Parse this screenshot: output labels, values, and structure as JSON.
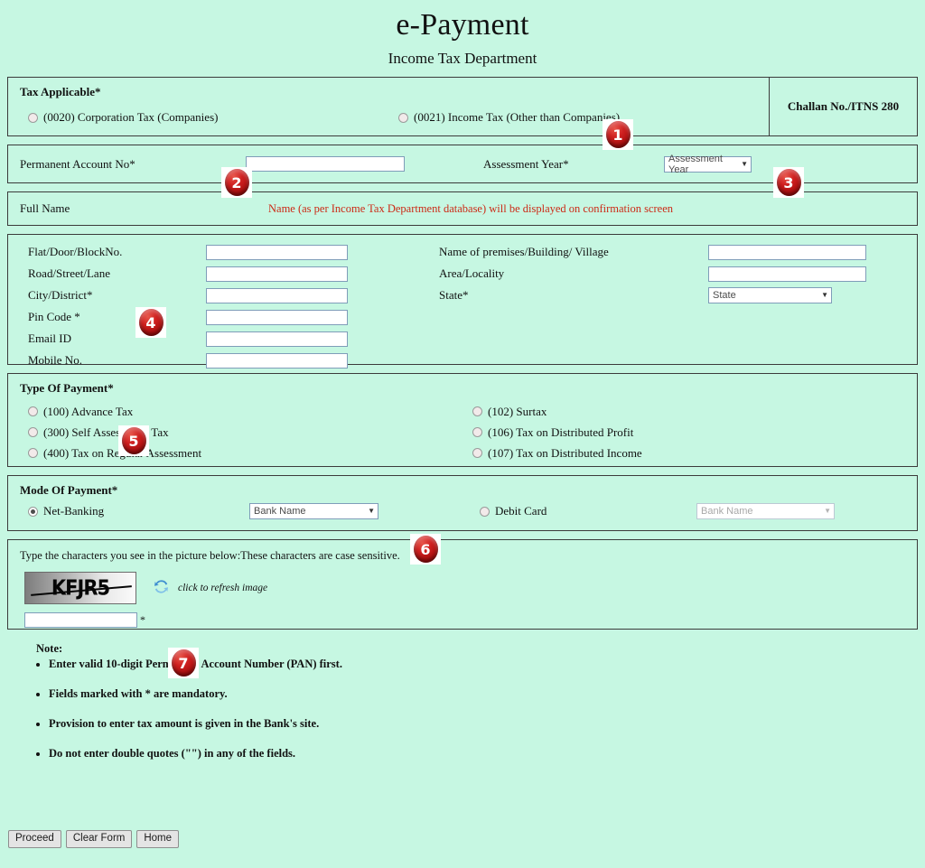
{
  "header": {
    "title": "e-Payment",
    "subtitle": "Income Tax Department"
  },
  "tax_applicable": {
    "title": "Tax Applicable*",
    "options": [
      {
        "label": "(0020) Corporation Tax (Companies)",
        "checked": false
      },
      {
        "label": "(0021) Income Tax (Other than Companies)",
        "checked": false
      }
    ],
    "challan_label": "Challan No./ITNS 280"
  },
  "pan": {
    "label": "Permanent Account No*",
    "value": "",
    "assessment_year_label": "Assessment Year*",
    "assessment_year_value": "Assessment Year"
  },
  "full_name": {
    "label": "Full Name",
    "note": "Name (as per Income Tax Department database) will be displayed on confirmation screen"
  },
  "address": {
    "left_fields": [
      {
        "label": "Flat/Door/BlockNo.",
        "value": ""
      },
      {
        "label": "Road/Street/Lane",
        "value": ""
      },
      {
        "label": "City/District*",
        "value": ""
      },
      {
        "label": "Pin Code *",
        "value": ""
      },
      {
        "label": "Email ID",
        "value": ""
      },
      {
        "label": "Mobile No.",
        "value": ""
      }
    ],
    "right_fields": [
      {
        "label": "Name of premises/Building/ Village",
        "value": "",
        "type": "text"
      },
      {
        "label": "Area/Locality",
        "value": "",
        "type": "text"
      },
      {
        "label": "State*",
        "value": "State",
        "type": "select"
      }
    ]
  },
  "payment_type": {
    "title": "Type Of Payment*",
    "left_options": [
      {
        "label": "(100) Advance Tax",
        "checked": false
      },
      {
        "label": "(300) Self Assessment Tax",
        "checked": false
      },
      {
        "label": "(400) Tax on Regular Assessment",
        "checked": false
      }
    ],
    "right_options": [
      {
        "label": "(102) Surtax",
        "checked": false
      },
      {
        "label": "(106) Tax on Distributed Profit",
        "checked": false
      },
      {
        "label": "(107) Tax on Distributed Income",
        "checked": false
      }
    ]
  },
  "payment_mode": {
    "title": "Mode Of Payment*",
    "net_banking_label": "Net-Banking",
    "net_banking_checked": true,
    "net_banking_bank": "Bank Name",
    "debit_card_label": "Debit Card",
    "debit_card_checked": false,
    "debit_card_bank": "Bank Name"
  },
  "captcha": {
    "instruction": "Type the characters you see in the picture below:These characters are case sensitive.",
    "image_text": "KFJR5",
    "refresh_caption": "click to refresh image",
    "input_value": "",
    "required_mark": "*"
  },
  "note": {
    "heading": "Note:",
    "items": [
      "Enter valid 10-digit Permanent Account Number (PAN) first.",
      "Fields marked with * are mandatory.",
      "Provision to enter tax amount is given in the Bank's site.",
      "Do not enter double quotes (\"\") in any of the fields."
    ]
  },
  "buttons": {
    "proceed": "Proceed",
    "clear_form": "Clear Form",
    "home": "Home"
  },
  "callouts": [
    {
      "number": "1"
    },
    {
      "number": "2"
    },
    {
      "number": "3"
    },
    {
      "number": "4"
    },
    {
      "number": "5"
    },
    {
      "number": "6"
    },
    {
      "number": "7"
    }
  ],
  "colors": {
    "page_background": "#c6f7e2",
    "border": "#3b3b3b",
    "note_red": "#cc2a16",
    "badge_red": "#cf2020",
    "input_border": "#7f9db9"
  }
}
